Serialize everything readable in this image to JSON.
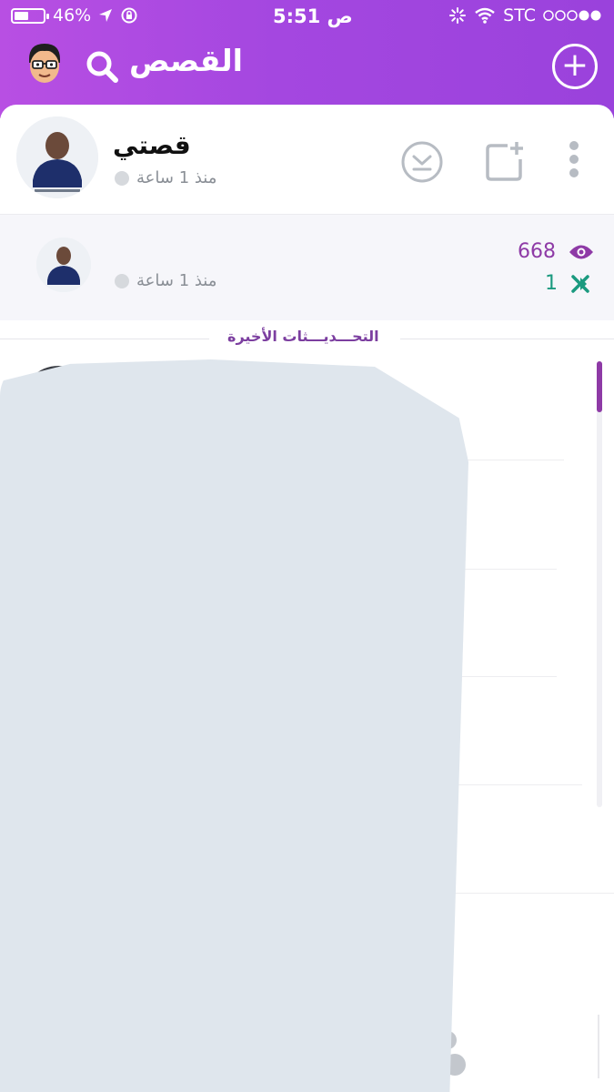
{
  "status_bar": {
    "battery": "46%",
    "time": "5:51",
    "time_suffix": "ص",
    "carrier": "STC"
  },
  "header": {
    "title": "القصص",
    "search_icon": "search-icon",
    "add_icon": "plus-icon"
  },
  "my_story": {
    "title": "قصتي",
    "time": "منذ 1 ساعة",
    "actions": [
      "save-story-icon",
      "add-snap-icon",
      "more-options-icon"
    ]
  },
  "snap": {
    "time": "منذ 1 ساعة",
    "views": "668",
    "screenshots": "1"
  },
  "recent_updates": {
    "label": "التحـــديـــثات الأخيرة"
  },
  "colors": {
    "header_start": "#b84fe3",
    "header_end": "#9a42dc",
    "accent_purple": "#8e3aa6",
    "screenshot_green": "#1b9a7f"
  }
}
